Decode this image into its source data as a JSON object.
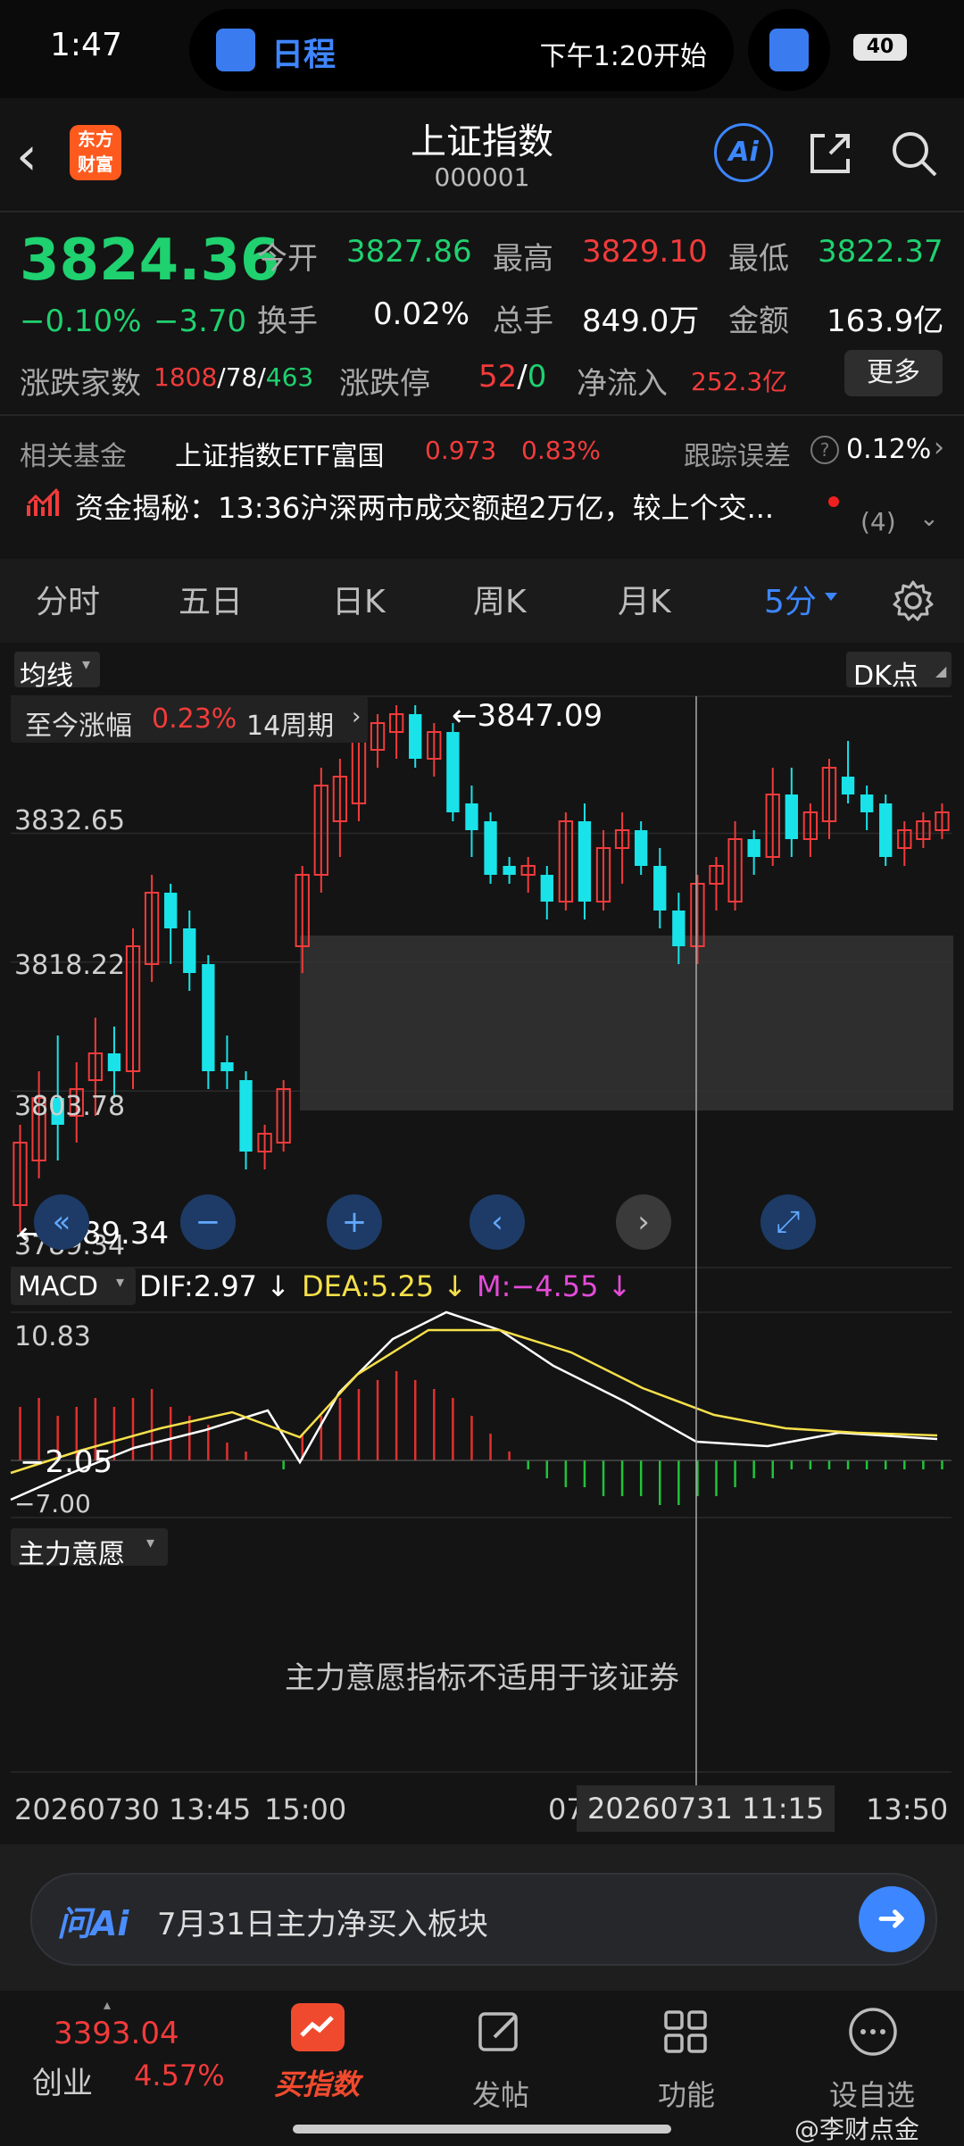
{
  "status_bar": {
    "time": "1:47",
    "island_title": "日程",
    "island_sub": "下午1:20开始",
    "battery": "40"
  },
  "header": {
    "back": "‹",
    "logo": "东方财富",
    "title": "上证指数",
    "code": "000001",
    "ai_label": "Ai"
  },
  "quote": {
    "price": "3824.36",
    "change_pct": "−0.10%",
    "change": "−3.70",
    "open_label": "今开",
    "open": "3827.86",
    "high_label": "最高",
    "high": "3829.10",
    "low_label": "最低",
    "low": "3822.37",
    "turnover_label": "换手",
    "turnover": "0.02%",
    "volume_label": "总手",
    "volume": "849.0万",
    "amount_label": "金额",
    "amount": "163.9亿",
    "breadth_label": "涨跌家数",
    "breadth_up": "1808",
    "breadth_flat": "78",
    "breadth_down": "463",
    "limit_label": "涨跌停",
    "limit_up": "52",
    "limit_down": "0",
    "netflow_label": "净流入",
    "netflow": "252.3亿",
    "more_button": "更多"
  },
  "fund": {
    "label": "相关基金",
    "name": "上证指数ETF富国",
    "price": "0.973",
    "change": "0.83%",
    "tracking_label": "跟踪误差",
    "tracking": "0.12%"
  },
  "news": {
    "text": "资金揭秘：13:36沪深两市成交额超2万亿，较上个交...",
    "count": "(4)"
  },
  "tabs": [
    "分时",
    "五日",
    "日K",
    "周K",
    "月K",
    "5分"
  ],
  "chart_controls": {
    "ma_label": "均线",
    "dk_label": "DK点",
    "range_label": "至今涨幅",
    "range_value": "0.23%",
    "range_period": "14周期",
    "max_marker": "←3847.09",
    "min_marker": "←3789.34",
    "y_ticks": [
      "3832.65",
      "3818.22",
      "3803.78",
      "3789.34"
    ]
  },
  "macd": {
    "label": "MACD",
    "dif": "DIF:2.97",
    "dea": "DEA:5.25",
    "m": "M:−4.55",
    "top": "10.83",
    "cross": "−2.05",
    "bottom": "−7.00"
  },
  "main_force": {
    "label": "主力意愿",
    "message": "主力意愿指标不适用于该证券"
  },
  "x_axis": {
    "start": "20260730 13:45",
    "t1": "15:00",
    "t2": "07",
    "cursor": "20260731 11:15",
    "end": "13:50"
  },
  "ask_ai": {
    "brand": "问Ai",
    "placeholder": "7月31日主力净买入板块"
  },
  "bottom_nav": {
    "ticker_value": "3393.04",
    "ticker_name": "创业",
    "ticker_change": "4.57%",
    "buy": "买指数",
    "post": "发帖",
    "functions": "功能",
    "watchlist": "设自选"
  },
  "watermark": "@李财点金",
  "chart_data": {
    "type": "candlestick",
    "interval": "5分",
    "ylim": [
      3789.34,
      3847.09
    ],
    "y_ticks": [
      3832.65,
      3818.22,
      3803.78,
      3789.34
    ],
    "candles": [
      {
        "o": 3791,
        "h": 3800,
        "l": 3788,
        "c": 3798
      },
      {
        "o": 3796,
        "h": 3806,
        "l": 3794,
        "c": 3803
      },
      {
        "o": 3803,
        "h": 3810,
        "l": 3796,
        "c": 3800
      },
      {
        "o": 3801,
        "h": 3807,
        "l": 3798,
        "c": 3804
      },
      {
        "o": 3805,
        "h": 3812,
        "l": 3801,
        "c": 3808
      },
      {
        "o": 3808,
        "h": 3811,
        "l": 3803,
        "c": 3806
      },
      {
        "o": 3806,
        "h": 3822,
        "l": 3804,
        "c": 3820
      },
      {
        "o": 3818,
        "h": 3828,
        "l": 3816,
        "c": 3826
      },
      {
        "o": 3826,
        "h": 3827,
        "l": 3818,
        "c": 3822
      },
      {
        "o": 3822,
        "h": 3824,
        "l": 3815,
        "c": 3817
      },
      {
        "o": 3818,
        "h": 3819,
        "l": 3804,
        "c": 3806
      },
      {
        "o": 3807,
        "h": 3810,
        "l": 3804,
        "c": 3806
      },
      {
        "o": 3805,
        "h": 3806,
        "l": 3795,
        "c": 3797
      },
      {
        "o": 3797,
        "h": 3800,
        "l": 3795,
        "c": 3799
      },
      {
        "o": 3798,
        "h": 3805,
        "l": 3797,
        "c": 3804
      },
      {
        "o": 3820,
        "h": 3829,
        "l": 3817,
        "c": 3828
      },
      {
        "o": 3828,
        "h": 3840,
        "l": 3826,
        "c": 3838
      },
      {
        "o": 3834,
        "h": 3841,
        "l": 3830,
        "c": 3839
      },
      {
        "o": 3836,
        "h": 3845,
        "l": 3834,
        "c": 3843
      },
      {
        "o": 3842,
        "h": 3846,
        "l": 3840,
        "c": 3845
      },
      {
        "o": 3844,
        "h": 3847,
        "l": 3841,
        "c": 3846
      },
      {
        "o": 3846,
        "h": 3847,
        "l": 3840,
        "c": 3841
      },
      {
        "o": 3841,
        "h": 3845,
        "l": 3839,
        "c": 3844
      },
      {
        "o": 3844,
        "h": 3845,
        "l": 3834,
        "c": 3835
      },
      {
        "o": 3836,
        "h": 3838,
        "l": 3830,
        "c": 3833
      },
      {
        "o": 3834,
        "h": 3835,
        "l": 3827,
        "c": 3828
      },
      {
        "o": 3829,
        "h": 3830,
        "l": 3827,
        "c": 3828
      },
      {
        "o": 3828,
        "h": 3830,
        "l": 3826,
        "c": 3829
      },
      {
        "o": 3828,
        "h": 3829,
        "l": 3823,
        "c": 3825
      },
      {
        "o": 3825,
        "h": 3835,
        "l": 3824,
        "c": 3834
      },
      {
        "o": 3834,
        "h": 3836,
        "l": 3823,
        "c": 3825
      },
      {
        "o": 3825,
        "h": 3833,
        "l": 3824,
        "c": 3831
      },
      {
        "o": 3831,
        "h": 3835,
        "l": 3827,
        "c": 3833
      },
      {
        "o": 3833,
        "h": 3834,
        "l": 3828,
        "c": 3829
      },
      {
        "o": 3829,
        "h": 3831,
        "l": 3822,
        "c": 3824
      },
      {
        "o": 3824,
        "h": 3826,
        "l": 3818,
        "c": 3820
      },
      {
        "o": 3820,
        "h": 3828,
        "l": 3818,
        "c": 3827
      },
      {
        "o": 3827,
        "h": 3830,
        "l": 3824,
        "c": 3829
      },
      {
        "o": 3825,
        "h": 3834,
        "l": 3824,
        "c": 3832
      },
      {
        "o": 3832,
        "h": 3833,
        "l": 3828,
        "c": 3830
      },
      {
        "o": 3830,
        "h": 3840,
        "l": 3829,
        "c": 3837
      },
      {
        "o": 3837,
        "h": 3840,
        "l": 3830,
        "c": 3832
      },
      {
        "o": 3832,
        "h": 3836,
        "l": 3830,
        "c": 3835
      },
      {
        "o": 3834,
        "h": 3841,
        "l": 3832,
        "c": 3840
      },
      {
        "o": 3839,
        "h": 3843,
        "l": 3836,
        "c": 3837
      },
      {
        "o": 3837,
        "h": 3838,
        "l": 3833,
        "c": 3835
      },
      {
        "o": 3836,
        "h": 3837,
        "l": 3829,
        "c": 3830
      },
      {
        "o": 3831,
        "h": 3834,
        "l": 3829,
        "c": 3833
      },
      {
        "o": 3832,
        "h": 3835,
        "l": 3831,
        "c": 3834
      },
      {
        "o": 3833,
        "h": 3836,
        "l": 3832,
        "c": 3835
      }
    ],
    "macd_hist": [
      6,
      7,
      5,
      6,
      7,
      6,
      7,
      8,
      6,
      5,
      4,
      2,
      1,
      0,
      -1,
      3,
      5,
      7,
      8,
      9,
      10,
      9,
      8,
      7,
      5,
      3,
      1,
      -1,
      -2,
      -3,
      -3,
      -4,
      -4,
      -4,
      -5,
      -5,
      -4,
      -4,
      -3,
      -2,
      -2,
      -1,
      -1,
      -1,
      -1,
      -1,
      -1,
      -1,
      -1,
      -1
    ]
  }
}
